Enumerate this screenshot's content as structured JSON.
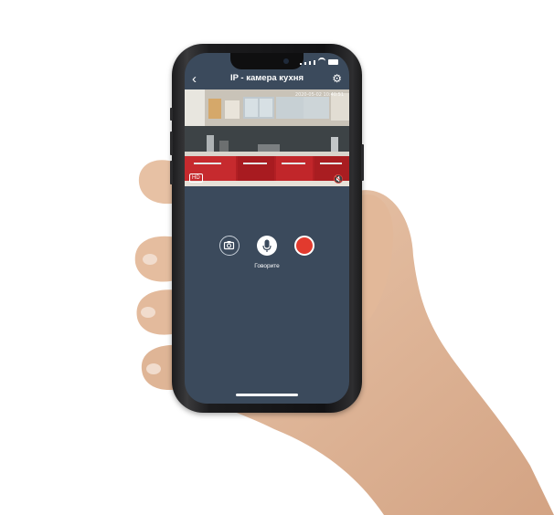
{
  "app": {
    "title": "IP - камера кухня",
    "back_icon": "chevron-left-icon",
    "settings_icon": "gear-icon"
  },
  "video": {
    "timestamp": "2020-05-02 10:40:51",
    "quality_badge": "HD",
    "mute_icon": "speaker-muted-icon"
  },
  "controls": {
    "snapshot_icon": "camera-icon",
    "mic_icon": "microphone-icon",
    "record_icon": "record-icon",
    "talk_label": "Говорите"
  },
  "colors": {
    "screen_bg": "#3b4a5c",
    "record_red": "#e23a2e",
    "kitchen_red": "#b21f24"
  }
}
